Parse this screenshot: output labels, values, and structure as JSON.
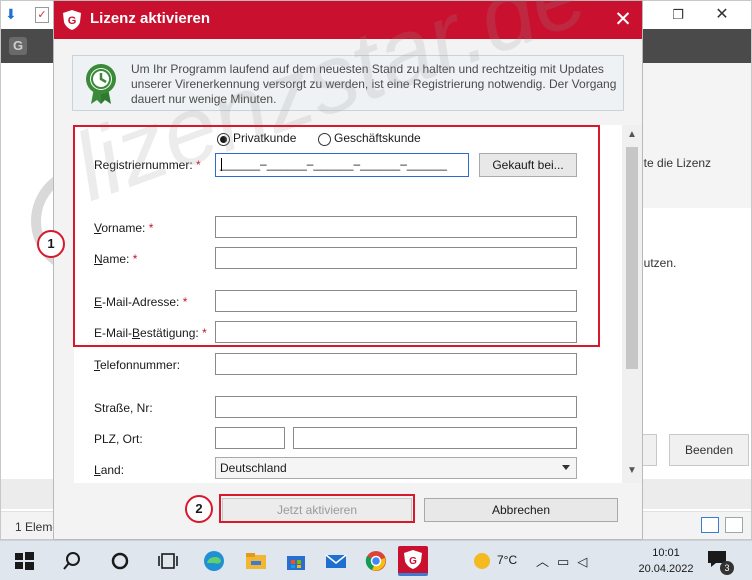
{
  "background_window": {
    "status_text": "1 Eleme",
    "right_text_1": "nte die Lizenz",
    "right_text_2": "nutzen.",
    "beenden_label": "Beenden"
  },
  "dialog": {
    "title": "Lizenz aktivieren",
    "info_text": "Um Ihr Programm laufend auf dem neuesten Stand zu halten und rechtzeitig mit Updates unserer Virenerkennung versorgt zu werden, ist eine Registrierung notwendig. Der Vorgang dauert nur wenige Minuten.",
    "customer_type": {
      "options": [
        "Privatkunde",
        "Geschäftskunde"
      ],
      "selected": "Privatkunde"
    },
    "fields": {
      "regnr": {
        "label": "Registriernummer:",
        "required": "*",
        "mask": "______–______–______–______–______"
      },
      "vorname": {
        "label_u": "V",
        "label_rest": "orname:",
        "required": "*",
        "value": ""
      },
      "name": {
        "label_u": "N",
        "label_rest": "ame:",
        "required": "*",
        "value": ""
      },
      "email": {
        "label_u": "E",
        "label_rest": "-Mail-Adresse:",
        "required": "*",
        "value": ""
      },
      "email_confirm": {
        "label_pre": "E-Mail-",
        "label_u": "B",
        "label_rest": "estätigung:",
        "required": "*",
        "value": ""
      },
      "telefon": {
        "label_u": "T",
        "label_rest": "elefonnummer:",
        "value": ""
      },
      "strasse": {
        "label": "Straße, Nr:",
        "value": ""
      },
      "plz_ort": {
        "label": "PLZ, Ort:",
        "plz_value": "",
        "ort_value": ""
      },
      "land": {
        "label_u": "L",
        "label_rest": "and:",
        "value": "Deutschland"
      }
    },
    "gekauft_label": "Gekauft bei...",
    "activate_label": "Jetzt aktivieren",
    "cancel_label": "Abbrechen"
  },
  "annotations": {
    "marker_1": "1",
    "marker_2": "2"
  },
  "watermark": "lizenzstar.de",
  "taskbar": {
    "temperature": "7°C",
    "time": "10:01",
    "date": "20.04.2022",
    "notification_count": "3"
  },
  "colors": {
    "titlebar": "#c9102f",
    "annotation": "#d7192e",
    "focus": "#2d6bd3"
  }
}
